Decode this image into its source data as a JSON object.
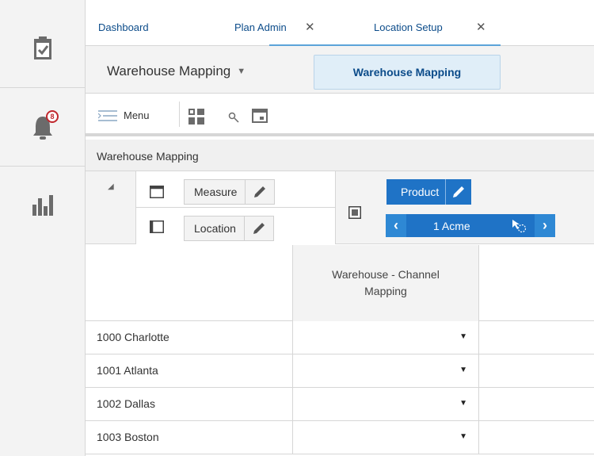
{
  "rail": {
    "items": [
      {
        "name": "tasks",
        "icon": "clipboard-check-icon"
      },
      {
        "name": "notifications",
        "icon": "bell-icon",
        "badge": "8"
      },
      {
        "name": "reports",
        "icon": "bar-chart-icon"
      }
    ]
  },
  "tabs": [
    {
      "label": "Dashboard",
      "closable": false
    },
    {
      "label": "Plan Admin",
      "closable": true
    },
    {
      "label": "Location Setup",
      "closable": true,
      "active": true
    }
  ],
  "subheader": {
    "view_select": "Warehouse Mapping",
    "view_button": "Warehouse Mapping"
  },
  "toolbar": {
    "menu_label": "Menu"
  },
  "panel": {
    "title": "Warehouse Mapping"
  },
  "pivot": {
    "row_dims": [
      "Measure",
      "Location"
    ],
    "page_dim": "Product",
    "page_value": "1 Acme"
  },
  "grid": {
    "column_header": "Warehouse - Channel Mapping",
    "rows": [
      "1000 Charlotte",
      "1001 Atlanta",
      "1002 Dallas",
      "1003 Boston"
    ]
  },
  "colors": {
    "accent": "#1f73c6",
    "tab_link": "#0c4c8a",
    "badge": "#c0272d"
  }
}
